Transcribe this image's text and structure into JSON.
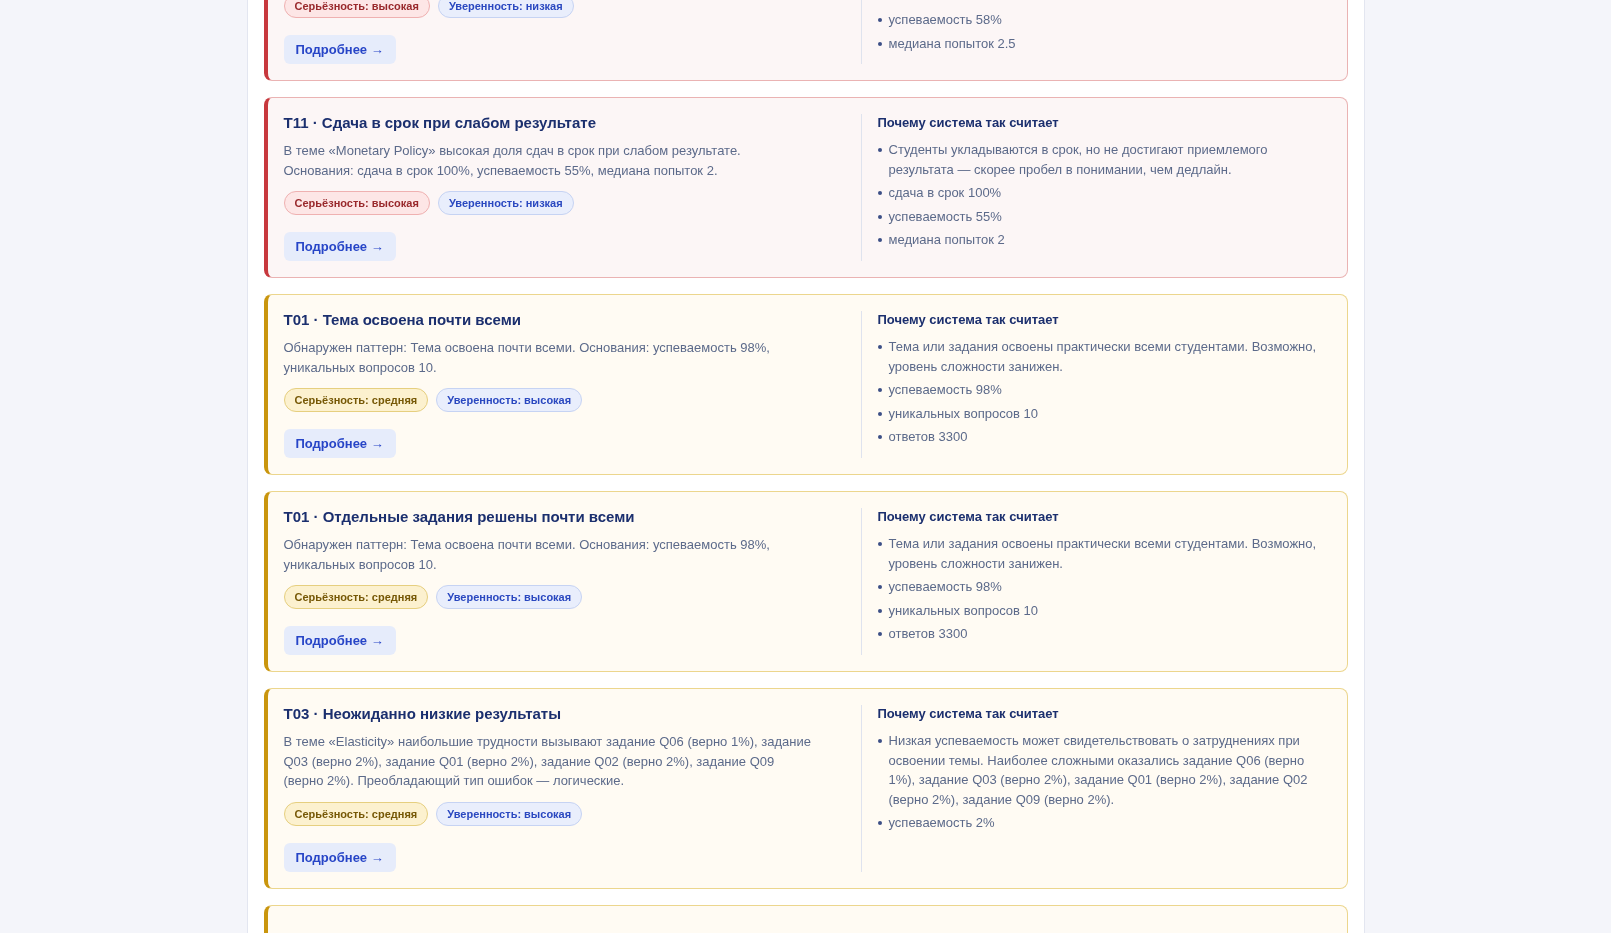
{
  "cards": [
    {
      "kind": "high",
      "severity_label": "Серьёзность: высокая",
      "confidence_label": "Уверенность: низкая",
      "button": "Подробнее →",
      "reasons": [
        "успеваемость 58%",
        "медиана попыток 2.5"
      ]
    },
    {
      "kind": "high",
      "title": "T11 · Сдача в срок при слабом результате",
      "description": "В теме «Monetary Policy» высокая доля сдач в срок при слабом результате. Основания: сдача в срок 100%, успеваемость 55%, медиана попыток 2.",
      "severity_label": "Серьёзность: высокая",
      "confidence_label": "Уверенность: низкая",
      "button": "Подробнее →",
      "why_title": "Почему система так считает",
      "reasons": [
        "Студенты укладываются в срок, но не достигают приемлемого результата — скорее пробел в понимании, чем дедлайн.",
        "сдача в срок 100%",
        "успеваемость 55%",
        "медиана попыток 2"
      ]
    },
    {
      "kind": "medium",
      "title": "T01 · Тема освоена почти всеми",
      "description": "Обнаружен паттерн: Тема освоена почти всеми. Основания: успеваемость 98%, уникальных вопросов 10.",
      "severity_label": "Серьёзность: средняя",
      "confidence_label": "Уверенность: высокая",
      "button": "Подробнее →",
      "why_title": "Почему система так считает",
      "reasons": [
        "Тема или задания освоены практически всеми студентами. Возможно, уровень сложности занижен.",
        "успеваемость 98%",
        "уникальных вопросов 10",
        "ответов 3300"
      ]
    },
    {
      "kind": "medium",
      "title": "T01 · Отдельные задания решены почти всеми",
      "description": "Обнаружен паттерн: Тема освоена почти всеми. Основания: успеваемость 98%, уникальных вопросов 10.",
      "severity_label": "Серьёзность: средняя",
      "confidence_label": "Уверенность: высокая",
      "button": "Подробнее →",
      "why_title": "Почему система так считает",
      "reasons": [
        "Тема или задания освоены практически всеми студентами. Возможно, уровень сложности занижен.",
        "успеваемость 98%",
        "уникальных вопросов 10",
        "ответов 3300"
      ]
    },
    {
      "kind": "medium",
      "title": "T03 · Неожиданно низкие результаты",
      "description": "В теме «Elasticity» наибольшие трудности вызывают задание Q06 (верно 1%), задание Q03 (верно 2%), задание Q01 (верно 2%), задание Q02 (верно 2%), задание Q09 (верно 2%). Преобладающий тип ошибок — логические.",
      "severity_label": "Серьёзность: средняя",
      "confidence_label": "Уверенность: высокая",
      "button": "Подробнее →",
      "why_title": "Почему система так считает",
      "reasons": [
        "Низкая успеваемость может свидетельствовать о затруднениях при освоении темы. Наиболее сложными оказались задание Q06 (верно 1%), задание Q03 (верно 2%), задание Q01 (верно 2%), задание Q02 (верно 2%), задание Q09 (верно 2%).",
        "успеваемость 2%"
      ]
    },
    {
      "kind": "medium"
    }
  ]
}
